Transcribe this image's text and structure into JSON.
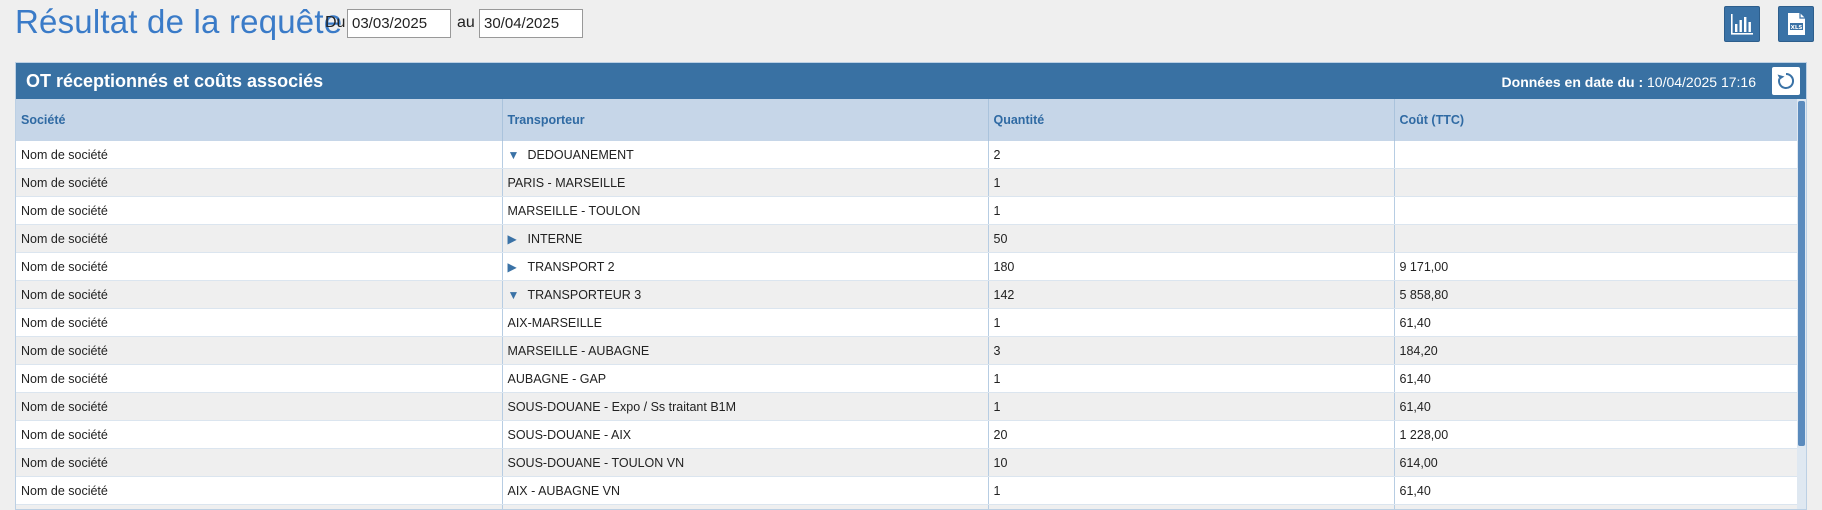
{
  "page": {
    "title": "Résultat de la requête",
    "from_label": "Du",
    "from_value": "03/03/2025",
    "to_label": "au",
    "to_value": "30/04/2025"
  },
  "toolbar": {
    "chart_icon": "bar-chart-icon",
    "export_icon": "xls-export-icon",
    "accent_color": "#3a72a6"
  },
  "panel": {
    "title": "OT réceptionnés et coûts associés",
    "date_label": "Données en date du :",
    "date_value": "10/04/2025 17:16",
    "refresh_icon": "refresh-icon",
    "header_color": "#3971a3"
  },
  "table": {
    "columns": [
      "Société",
      "Transporteur",
      "Quantité",
      "Coût (TTC)"
    ],
    "rows": [
      {
        "societe": "Nom de société",
        "transporteur": "DEDOUANEMENT",
        "toggle": "expanded",
        "quantite": "2",
        "cout": ""
      },
      {
        "societe": "Nom de société",
        "transporteur": "PARIS - MARSEILLE",
        "toggle": "",
        "quantite": "1",
        "cout": ""
      },
      {
        "societe": "Nom de société",
        "transporteur": "MARSEILLE - TOULON",
        "toggle": "",
        "quantite": "1",
        "cout": ""
      },
      {
        "societe": "Nom de société",
        "transporteur": "INTERNE",
        "toggle": "collapsed",
        "quantite": "50",
        "cout": ""
      },
      {
        "societe": "Nom de société",
        "transporteur": "TRANSPORT 2",
        "toggle": "collapsed",
        "quantite": "180",
        "cout": "9 171,00"
      },
      {
        "societe": "Nom de société",
        "transporteur": "TRANSPORTEUR 3",
        "toggle": "expanded",
        "quantite": "142",
        "cout": "5 858,80"
      },
      {
        "societe": "Nom de société",
        "transporteur": "AIX-MARSEILLE",
        "toggle": "",
        "quantite": "1",
        "cout": "61,40"
      },
      {
        "societe": "Nom de société",
        "transporteur": "MARSEILLE - AUBAGNE",
        "toggle": "",
        "quantite": "3",
        "cout": "184,20"
      },
      {
        "societe": "Nom de société",
        "transporteur": "AUBAGNE - GAP",
        "toggle": "",
        "quantite": "1",
        "cout": "61,40"
      },
      {
        "societe": "Nom de société",
        "transporteur": "SOUS-DOUANE - Expo / Ss traitant B1M",
        "toggle": "",
        "quantite": "1",
        "cout": "61,40"
      },
      {
        "societe": "Nom de société",
        "transporteur": "SOUS-DOUANE - AIX",
        "toggle": "",
        "quantite": "20",
        "cout": "1 228,00"
      },
      {
        "societe": "Nom de société",
        "transporteur": "SOUS-DOUANE - TOULON VN",
        "toggle": "",
        "quantite": "10",
        "cout": "614,00"
      },
      {
        "societe": "Nom de société",
        "transporteur": "AIX - AUBAGNE VN",
        "toggle": "",
        "quantite": "1",
        "cout": "61,40"
      },
      {
        "societe": "Nom de société",
        "transporteur": "",
        "toggle": "",
        "quantite": "",
        "cout": ""
      }
    ]
  }
}
